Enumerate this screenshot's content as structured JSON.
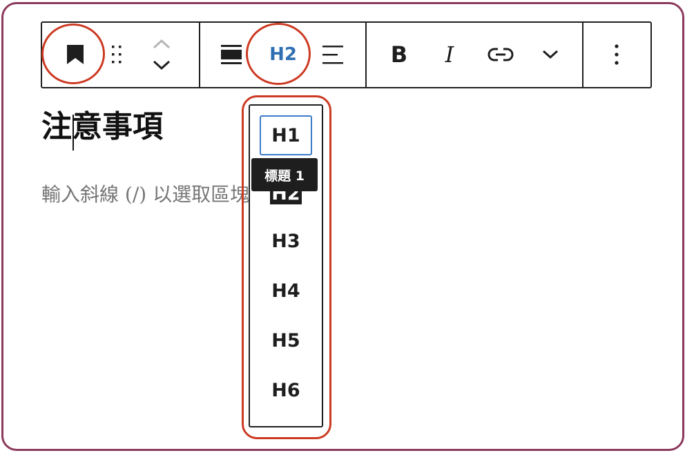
{
  "toolbar": {
    "heading_level": "H2",
    "bold_label": "B",
    "italic_label": "I"
  },
  "editor": {
    "heading_text": "注意事項",
    "placeholder_text": "輸入斜線 (/) 以選取區塊"
  },
  "heading_dropdown": {
    "items": [
      {
        "label": "H1",
        "state": "focused"
      },
      {
        "label": "H2",
        "state": "active"
      },
      {
        "label": "H3",
        "state": "normal"
      },
      {
        "label": "H4",
        "state": "normal"
      },
      {
        "label": "H5",
        "state": "normal"
      },
      {
        "label": "H6",
        "state": "normal"
      }
    ],
    "tooltip": "標題 1"
  },
  "colors": {
    "frame_border": "#8c3a5c",
    "highlight_ring": "#cc3a22",
    "accent_blue": "#2f6fb1",
    "text_dark": "#1e1e1e",
    "placeholder_gray": "#757575"
  },
  "icons": {
    "block_type": "bookmark-icon",
    "drag": "drag-handle-icon",
    "move_up": "chevron-up-icon",
    "move_down": "chevron-down-icon",
    "align": "align-full-width-icon",
    "text_align": "align-left-icon",
    "link": "link-icon",
    "more_rich_text": "chevron-down-icon",
    "options": "more-vertical-icon"
  }
}
